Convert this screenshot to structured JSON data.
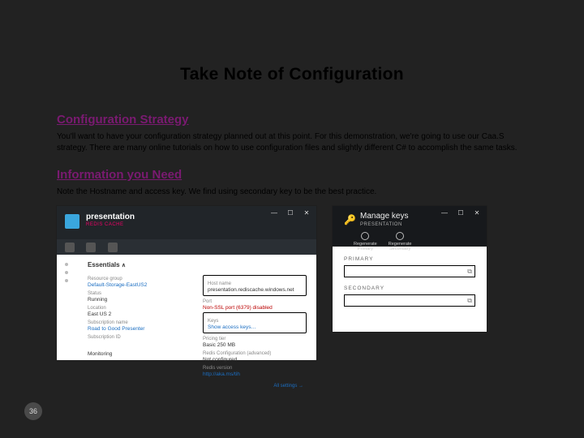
{
  "title": "Take Note of Configuration",
  "sections": {
    "strategy": {
      "heading": "Configuration Strategy",
      "body": "You'll want to have your configuration strategy planned out at this point.  For this demonstration, we're going to use our Caa.S strategy.  There are many online tutorials on how to use configuration files and slightly different C# to accomplish the same tasks."
    },
    "info": {
      "heading": "Information you Need",
      "body": "Note the Hostname and access key.   We find using secondary key to be the best practice."
    }
  },
  "shot_a": {
    "app_title": "presentation",
    "app_sub": "REDIS CACHE",
    "essentials": "Essentials",
    "left": {
      "l1_label": "Resource group",
      "l1_value": "Default-Storage-EastUS2",
      "l2_label": "Status",
      "l2_value": "Running",
      "l3_label": "Location",
      "l3_value": "East US 2",
      "l4_label": "Subscription name",
      "l4_value": "Road to Good Presenter",
      "l5_label": "Subscription ID"
    },
    "right": {
      "r1_label": "Host name",
      "r1_value": "presentation.rediscache.windows.net",
      "r2_label": "Port",
      "r2_extra": "Non-SSL port (6379) disabled",
      "r3_label": "Keys",
      "r3_value": "Show access keys…",
      "r4_label": "Pricing tier",
      "r4_value": "Basic 250 MB",
      "r5_label": "Redis Configuration (advanced)",
      "r5_value": "Not configured",
      "r6_label": "Redis version",
      "r6_value": "http://aka.ms/tih"
    },
    "footer": "All settings  →",
    "bottom": "Monitoring"
  },
  "shot_b": {
    "title": "Manage keys",
    "sub": "PRESENTATION",
    "tab1_top": "Regenerate",
    "tab1_bot": "Primary",
    "tab2_top": "Regenerate",
    "tab2_bot": "Secondary",
    "primary": "PRIMARY",
    "secondary": "SECONDARY"
  },
  "page_number": "36"
}
